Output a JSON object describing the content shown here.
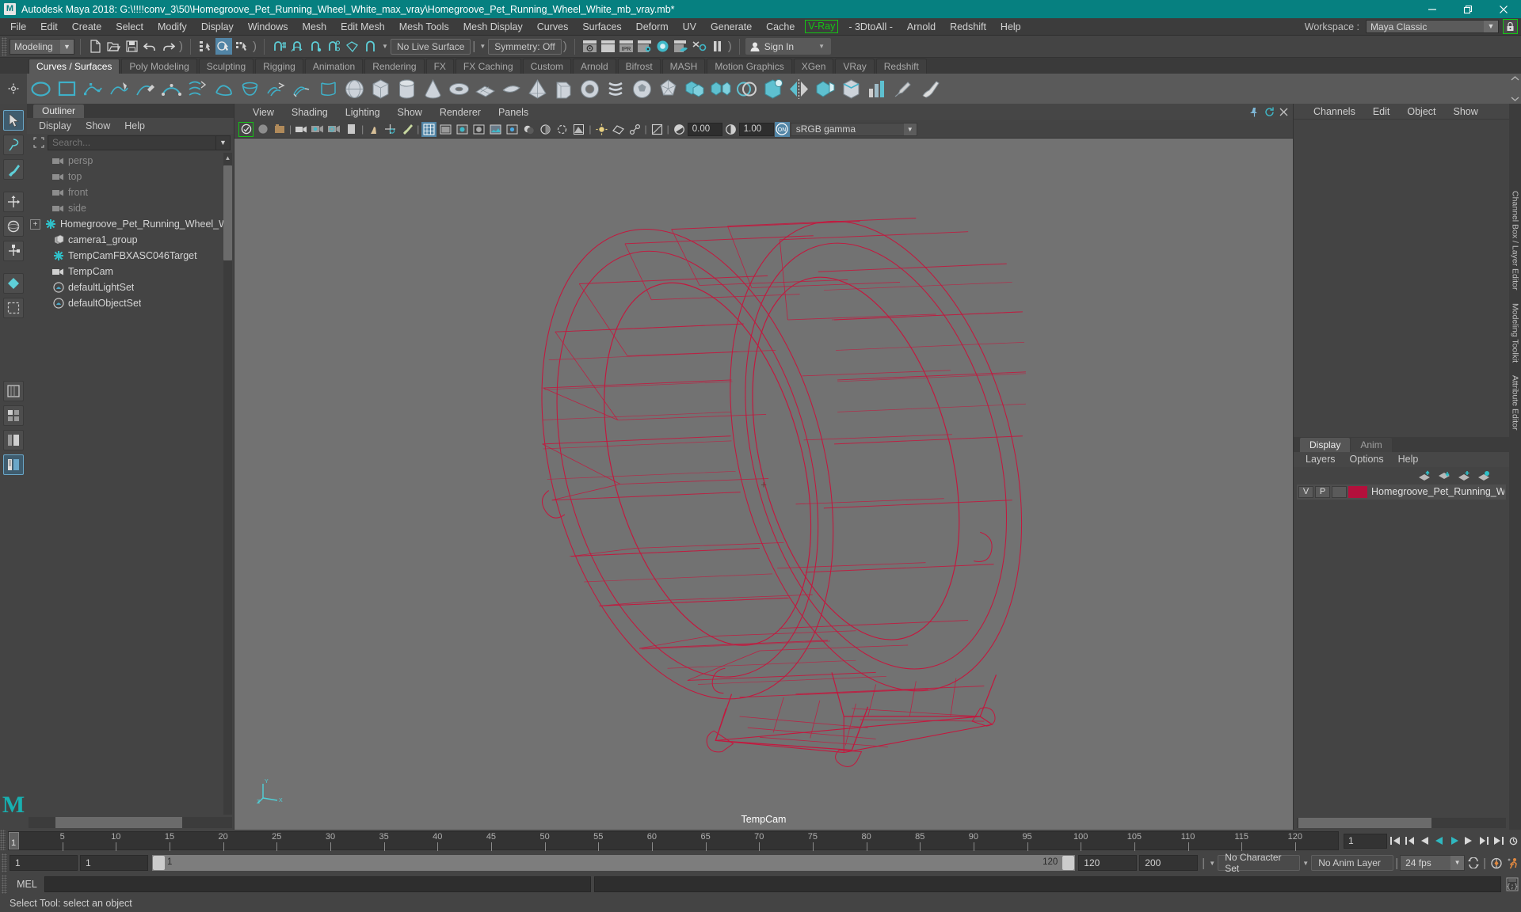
{
  "window": {
    "title": "Autodesk Maya 2018: G:\\!!!!conv_3\\50\\Homegroove_Pet_Running_Wheel_White_max_vray\\Homegroove_Pet_Running_Wheel_White_mb_vray.mb*",
    "logo": "M",
    "minimize": "—",
    "restore": "❐",
    "close": "✕"
  },
  "menubar": {
    "items": [
      "File",
      "Edit",
      "Create",
      "Select",
      "Modify",
      "Display",
      "Windows",
      "Mesh",
      "Edit Mesh",
      "Mesh Tools",
      "Mesh Display",
      "Curves",
      "Surfaces",
      "Deform",
      "UV",
      "Generate",
      "Cache",
      "V-Ray",
      "- 3DtoAll -",
      "Arnold",
      "Redshift",
      "Help"
    ],
    "highlight_item": "V-Ray",
    "workspace_label": "Workspace :",
    "workspace_value": "Maya Classic",
    "lock_icon": "lock-icon"
  },
  "statusline": {
    "mode": "Modeling",
    "live_surface": "No Live Surface",
    "symmetry": "Symmetry: Off",
    "signin": "Sign In"
  },
  "shelf": {
    "tabs": [
      "Curves / Surfaces",
      "Poly Modeling",
      "Sculpting",
      "Rigging",
      "Animation",
      "Rendering",
      "FX",
      "FX Caching",
      "Custom",
      "Arnold",
      "Bifrost",
      "MASH",
      "Motion Graphics",
      "XGen",
      "VRay",
      "Redshift"
    ],
    "active_tab": "Curves / Surfaces"
  },
  "outliner": {
    "tab": "Outliner",
    "menus": [
      "Display",
      "Show",
      "Help"
    ],
    "search_placeholder": "Search...",
    "items": [
      {
        "label": "persp",
        "icon": "camera-icon",
        "dim": true,
        "expand": false
      },
      {
        "label": "top",
        "icon": "camera-icon",
        "dim": true,
        "expand": false
      },
      {
        "label": "front",
        "icon": "camera-icon",
        "dim": true,
        "expand": false
      },
      {
        "label": "side",
        "icon": "camera-icon",
        "dim": true,
        "expand": false
      },
      {
        "label": "Homegroove_Pet_Running_Wheel_W",
        "icon": "transform-icon",
        "dim": false,
        "expand": true
      },
      {
        "label": "camera1_group",
        "icon": "group-icon",
        "dim": false,
        "expand": false
      },
      {
        "label": "TempCamFBXASC046Target",
        "icon": "transform-icon",
        "dim": false,
        "expand": false
      },
      {
        "label": "TempCam",
        "icon": "camera-icon",
        "dim": false,
        "expand": false
      },
      {
        "label": "defaultLightSet",
        "icon": "set-icon",
        "dim": false,
        "expand": false
      },
      {
        "label": "defaultObjectSet",
        "icon": "set-icon",
        "dim": false,
        "expand": false
      }
    ]
  },
  "viewport": {
    "menus": [
      "View",
      "Shading",
      "Lighting",
      "Show",
      "Renderer",
      "Panels"
    ],
    "exposure": "0.00",
    "gamma_value": "1.00",
    "color_space": "sRGB gamma",
    "camera_label": "TempCam",
    "axis_labels": {
      "y": "Y",
      "x": "X",
      "z": "Z"
    },
    "model_color": "#c8143c",
    "background_color": "#727272"
  },
  "channelbox": {
    "menus": [
      "Channels",
      "Edit",
      "Object",
      "Show"
    ]
  },
  "layers": {
    "tabs": [
      "Display",
      "Anim"
    ],
    "active_tab": "Display",
    "menus": [
      "Layers",
      "Options",
      "Help"
    ],
    "rows": [
      {
        "v": "V",
        "p": "P",
        "color": "#b4103c",
        "name": "Homegroove_Pet_Running_Wl"
      }
    ]
  },
  "vertical_tabs": [
    "Channel Box / Layer Editor",
    "Modeling Toolkit",
    "Attribute Editor"
  ],
  "timeline": {
    "ticks": [
      {
        "value": "5",
        "pos": 5
      },
      {
        "value": "10",
        "pos": 10
      },
      {
        "value": "15",
        "pos": 15
      },
      {
        "value": "20",
        "pos": 20
      },
      {
        "value": "25",
        "pos": 25
      },
      {
        "value": "30",
        "pos": 30
      },
      {
        "value": "35",
        "pos": 35
      },
      {
        "value": "40",
        "pos": 40
      },
      {
        "value": "45",
        "pos": 45
      },
      {
        "value": "50",
        "pos": 50
      },
      {
        "value": "55",
        "pos": 55
      },
      {
        "value": "60",
        "pos": 60
      },
      {
        "value": "65",
        "pos": 65
      },
      {
        "value": "70",
        "pos": 70
      },
      {
        "value": "75",
        "pos": 75
      },
      {
        "value": "80",
        "pos": 80
      },
      {
        "value": "85",
        "pos": 85
      },
      {
        "value": "90",
        "pos": 90
      },
      {
        "value": "95",
        "pos": 95
      },
      {
        "value": "100",
        "pos": 100
      },
      {
        "value": "105",
        "pos": 105
      },
      {
        "value": "110",
        "pos": 110
      },
      {
        "value": "115",
        "pos": 115
      },
      {
        "value": "120",
        "pos": 120
      }
    ],
    "current_frame": "1",
    "current_frame_field": "1",
    "range_start": "1",
    "range_end": "1",
    "range_bar_start": "1",
    "range_bar_end": "120",
    "playback_end": "120",
    "anim_end": "200",
    "character_set": "No Character Set",
    "anim_layer": "No Anim Layer",
    "fps": "24 fps"
  },
  "mel": {
    "label": "MEL",
    "value": ""
  },
  "statusbar": {
    "text": "Select Tool: select an object"
  }
}
